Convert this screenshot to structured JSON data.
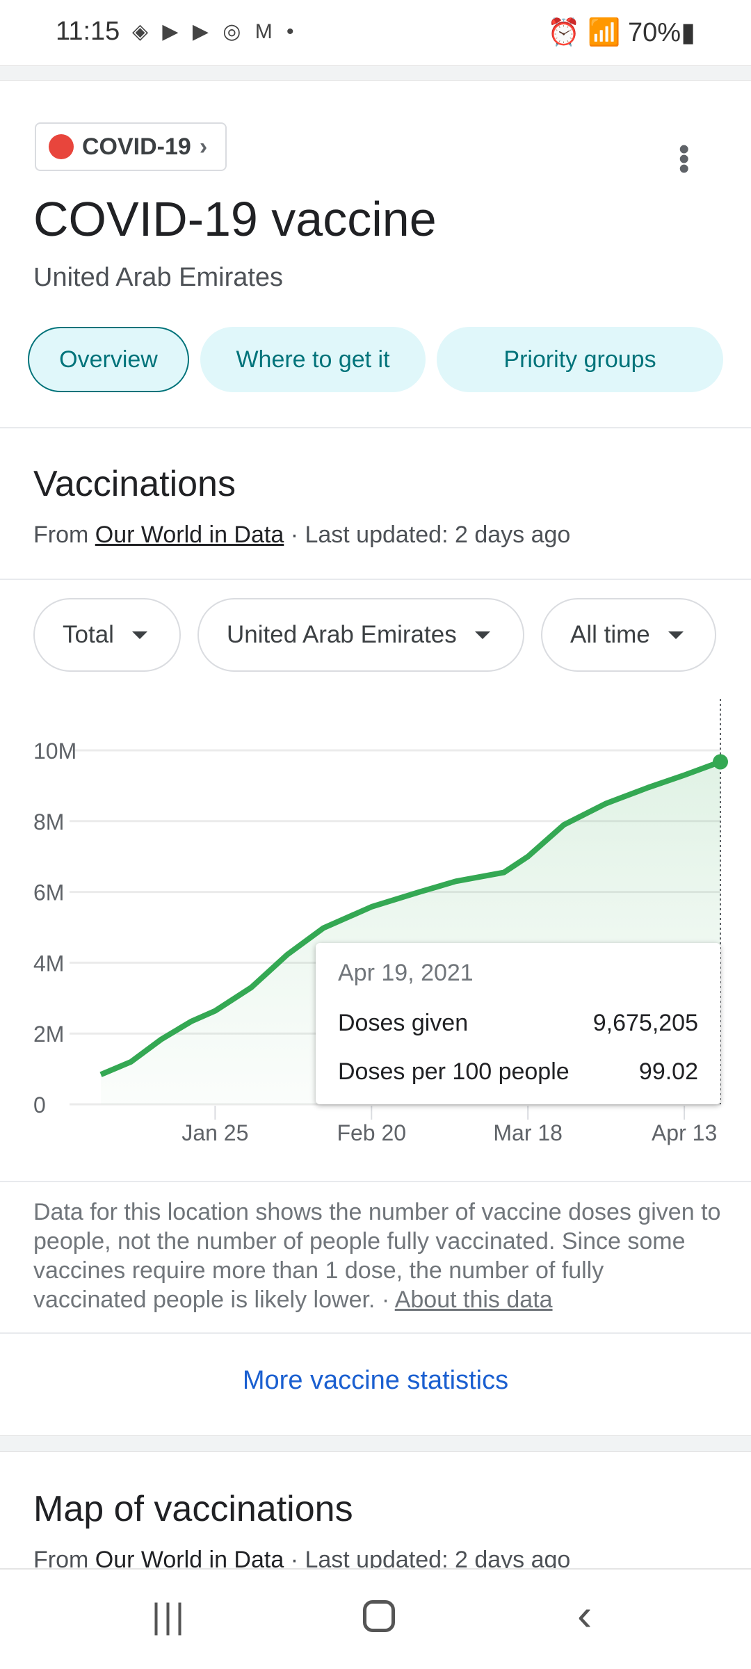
{
  "status_bar": {
    "time": "11:15",
    "battery": "70%"
  },
  "header": {
    "chip_label": "COVID-19",
    "title": "COVID-19 vaccine",
    "subtitle": "United Arab Emirates",
    "tabs": [
      {
        "label": "Overview",
        "selected": true
      },
      {
        "label": "Where to get it"
      },
      {
        "label": "Priority groups"
      }
    ]
  },
  "vaccinations": {
    "heading": "Vaccinations",
    "source_prefix": "From ",
    "source_link": "Our World in Data",
    "updated": " · Last updated: 2 days ago",
    "filters": [
      "Total",
      "United Arab Emirates",
      "All time"
    ],
    "tooltip": {
      "date": "Apr 19, 2021",
      "rows": [
        {
          "label": "Doses given",
          "value": "9,675,205"
        },
        {
          "label": "Doses per 100 people",
          "value": "99.02"
        }
      ]
    },
    "note": "Data for this location shows the number of vaccine doses given to people, not the number of people fully vaccinated. Since some vaccines require more than 1 dose, the number of fully vaccinated people is likely lower. · ",
    "note_link": "About this data",
    "more_link": "More vaccine statistics"
  },
  "map_section": {
    "heading": "Map of vaccinations",
    "source_prefix": "From ",
    "source_link": "Our World in Data",
    "updated": " · Last updated: 2 days ago"
  },
  "chart_data": {
    "type": "area",
    "xlabel": "",
    "ylabel": "",
    "ylim": [
      0,
      10000000
    ],
    "grid": true,
    "color": "#34a853",
    "yticks": [
      "0",
      "2M",
      "4M",
      "6M",
      "8M",
      "10M"
    ],
    "ytick_values": [
      0,
      2000000,
      4000000,
      6000000,
      8000000,
      10000000
    ],
    "xticks": [
      "Jan 25",
      "Feb 20",
      "Mar 18",
      "Apr 13"
    ],
    "x": [
      "2021-01-06",
      "2021-01-11",
      "2021-01-16",
      "2021-01-21",
      "2021-01-25",
      "2021-01-31",
      "2021-02-06",
      "2021-02-12",
      "2021-02-20",
      "2021-02-28",
      "2021-03-06",
      "2021-03-14",
      "2021-03-18",
      "2021-03-24",
      "2021-03-31",
      "2021-04-07",
      "2021-04-13",
      "2021-04-19"
    ],
    "y": [
      840000,
      1200000,
      1830000,
      2340000,
      2640000,
      3300000,
      4230000,
      4980000,
      5580000,
      6000000,
      6300000,
      6550000,
      7000000,
      7900000,
      8500000,
      8950000,
      9300000,
      9675205
    ]
  }
}
